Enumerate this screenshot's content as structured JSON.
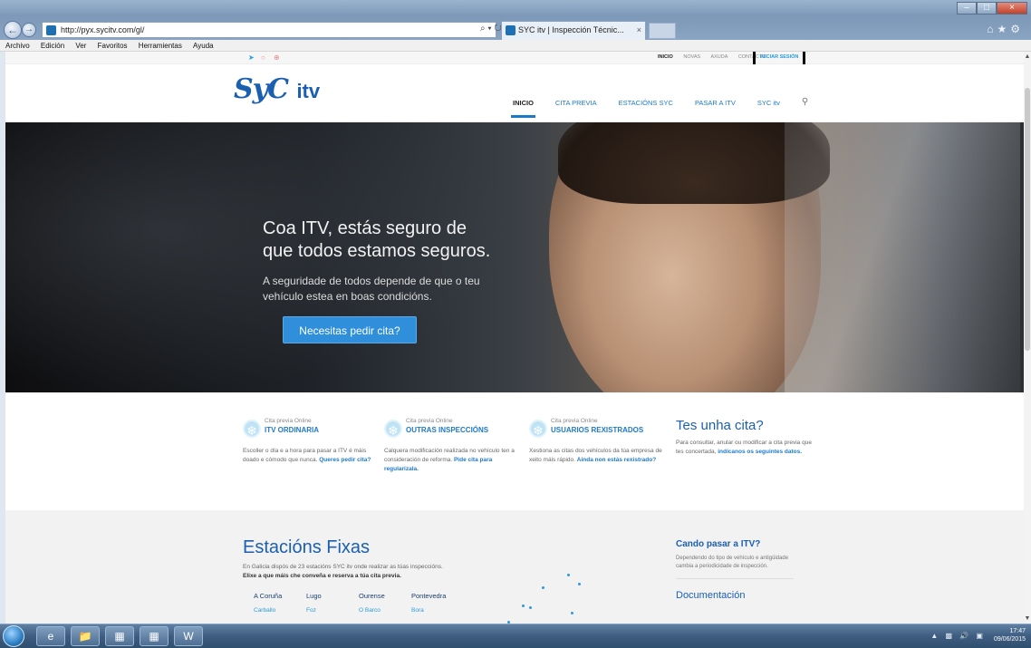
{
  "browser": {
    "url": "http://pyx.sycitv.com/gl/",
    "search_refresh": "⌕ ▾ ↻",
    "tab_title": "SYC itv | Inspección Técnic...",
    "tab_close": "×",
    "menu": [
      "Archivo",
      "Edición",
      "Ver",
      "Favoritos",
      "Herramientas",
      "Ayuda"
    ]
  },
  "site": {
    "toplinks": [
      "INICIO",
      "NOVAS",
      "AXUDA",
      "CONTACTO"
    ],
    "login": "INICIAR SESIÓN",
    "logo_main": "SyC",
    "logo_sub": "itv",
    "nav": [
      "INICIO",
      "CITA PREVIA",
      "ESTACIÓNS SYC",
      "PASAR A ITV",
      "SYC itv"
    ]
  },
  "hero": {
    "title_line1": "Coa ITV, estás seguro de",
    "title_line2": "que todos estamos seguros.",
    "text": "A seguridade de todos depende de que o teu vehículo estea en boas condicións.",
    "cta": "Necesitas pedir cita?"
  },
  "cards": [
    {
      "small": "Cita previa Online",
      "title": "ITV ORDINARIA",
      "desc": "Escoller o día e a hora para pasar a ITV é máis doado e cómodo que nunca. ",
      "link": "Queres pedir cita?"
    },
    {
      "small": "Cita previa Online",
      "title": "OUTRAS INSPECCIÓNS",
      "desc": "Calquera modificación realizada no vehículo ten a consideración de reforma. ",
      "link": "Pide cita para regularizala."
    },
    {
      "small": "Cita previa Online",
      "title": "USUARIOS REXISTRADOS",
      "desc": "Xestiona as citas dos vehículos da túa empresa de xeito máis rápido. ",
      "link": "Ainda non estás rexistrado?"
    }
  ],
  "cita": {
    "title": "Tes unha cita?",
    "desc": "Para consultar, anular ou modificar a cita previa que tes concertada, ",
    "link": "indícanos os seguintes datos."
  },
  "stations": {
    "title": "Estacións Fixas",
    "intro": "En Galicia dispós de 23 estacións SYC itv onde realizar as túas inspeccións.",
    "intro_bold": "Elixe a que máis che conveña e reserva a túa cita previa.",
    "provinces": [
      {
        "name": "A Coruña",
        "city": "Carballo"
      },
      {
        "name": "Lugo",
        "city": "Foz"
      },
      {
        "name": "Ourense",
        "city": "O Barco"
      },
      {
        "name": "Pontevedra",
        "city": "Bora"
      }
    ]
  },
  "side": {
    "title": "Cando pasar a ITV?",
    "desc": "Dependendo do tipo de vehículo e antigüidade cambia a periodicidade de inspección.",
    "doc": "Documentación"
  },
  "taskbar": {
    "time": "17:47",
    "date": "09/06/2015"
  },
  "colors": {
    "accent": "#1b7ac8",
    "cta": "#2f8fdb",
    "logo": "#1b5fb0"
  }
}
